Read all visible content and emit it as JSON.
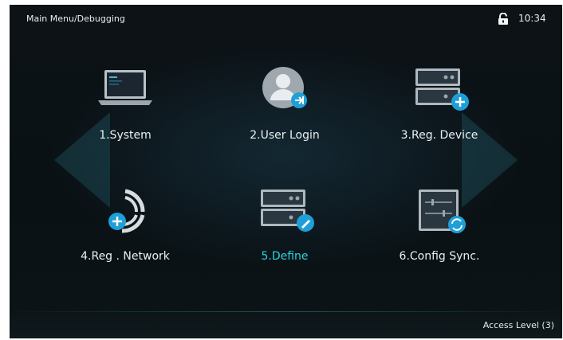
{
  "header": {
    "breadcrumb": "Main Menu/Debugging",
    "time": "10:34",
    "lock_icon": "lock-open-icon"
  },
  "menu": {
    "items": [
      {
        "label": "1.System",
        "icon": "laptop-icon",
        "active": false
      },
      {
        "label": "2.User Login",
        "icon": "user-login-icon",
        "active": false
      },
      {
        "label": "3.Reg. Device",
        "icon": "server-add-icon",
        "active": false
      },
      {
        "label": "4.Reg . Network",
        "icon": "network-add-icon",
        "active": false
      },
      {
        "label": "5.Define",
        "icon": "server-edit-icon",
        "active": true
      },
      {
        "label": "6.Config Sync.",
        "icon": "sync-settings-icon",
        "active": false
      }
    ]
  },
  "footer": {
    "access_level": "Access Level  (3)"
  },
  "colors": {
    "background": "#0b1216",
    "active_label": "#2fd1dc",
    "badge": "#1f9fd8"
  }
}
